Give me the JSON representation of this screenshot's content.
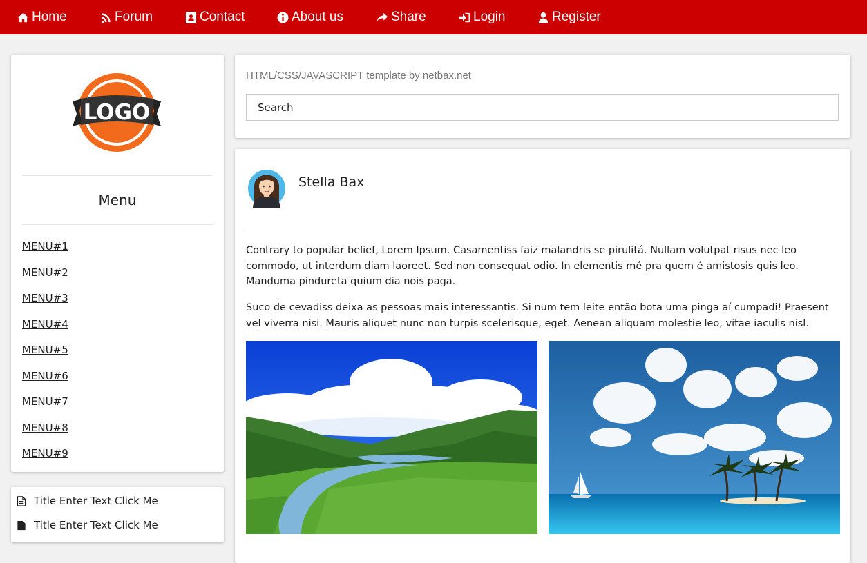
{
  "nav": {
    "items": [
      {
        "label": "Home",
        "icon": "home-icon"
      },
      {
        "label": "Forum",
        "icon": "rss-icon"
      },
      {
        "label": "Contact",
        "icon": "contact-book-icon"
      },
      {
        "label": "About us",
        "icon": "info-circle-icon"
      },
      {
        "label": "Share",
        "icon": "share-arrow-icon"
      },
      {
        "label": "Login",
        "icon": "sign-in-icon"
      },
      {
        "label": "Register",
        "icon": "user-icon"
      }
    ],
    "background": "#cc0000"
  },
  "sidebar": {
    "logo_text": "LOGO",
    "menu_title": "Menu",
    "menu_items": [
      "MENU#1",
      "MENU#2",
      "MENU#3",
      "MENU#4",
      "MENU#5",
      "MENU#6",
      "MENU#7",
      "MENU#8",
      "MENU#9"
    ]
  },
  "titles": {
    "items": [
      "Title Enter Text Click Me",
      "Title Enter Text Click Me"
    ]
  },
  "header": {
    "tagline": "HTML/CSS/JAVASCRIPT template by netbax.net",
    "search_placeholder": "Search"
  },
  "post": {
    "author": "Stella Bax",
    "paragraphs": [
      "Contrary to popular belief, Lorem Ipsum. Casamentiss faiz malandris se pirulitá. Nullam volutpat risus nec leo commodo, ut interdum diam laoreet. Sed non consequat odio. In elementis mé pra quem é amistosis quis leo. Manduma pindureta quium dia nois paga.",
      "Suco de cevadiss deixa as pessoas mais interessantis. Si num tem leite então bota uma pinga aí cumpadi! Praesent vel viverra nisi. Mauris aliquet nunc non turpis scelerisque, eget. Aenean aliquam molestie leo, vitae iaculis nisl."
    ]
  }
}
